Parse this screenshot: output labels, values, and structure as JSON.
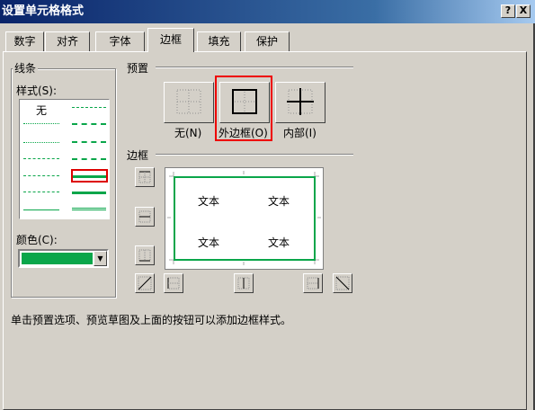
{
  "window": {
    "title": "设置单元格格式",
    "help_label": "?",
    "close_label": "X"
  },
  "tabs": [
    {
      "label": "数字",
      "active": false
    },
    {
      "label": "对齐",
      "active": false
    },
    {
      "label": "字体",
      "active": false
    },
    {
      "label": "边框",
      "active": true
    },
    {
      "label": "填充",
      "active": false
    },
    {
      "label": "保护",
      "active": false
    }
  ],
  "line_group": {
    "title": "线条",
    "style_label": "样式(S):",
    "style_none": "无",
    "color_label": "颜色(C):",
    "selected_color": "#0aa64a"
  },
  "presets": {
    "title": "预置",
    "none_label": "无(N)",
    "outline_label": "外边框(O)",
    "inside_label": "内部(I)"
  },
  "border": {
    "title": "边框",
    "preview_text": [
      "文本",
      "文本",
      "文本",
      "文本"
    ],
    "border_color": "#0aa64a"
  },
  "hint_text": "单击预置选项、预览草图及上面的按钮可以添加边框样式。",
  "colors": {
    "highlight": "#e00000",
    "dialog_bg": "#d4d0c8"
  }
}
